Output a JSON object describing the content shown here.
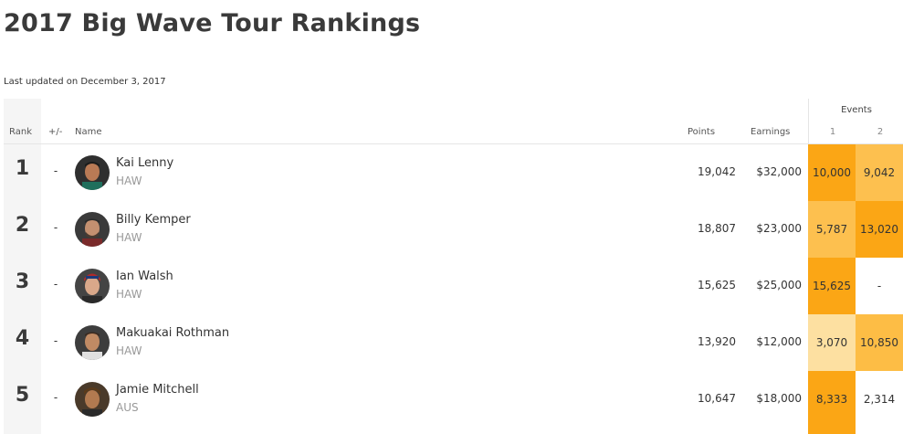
{
  "title": "2017 Big Wave Tour Rankings",
  "updated": "Last updated on December 3, 2017",
  "columns": {
    "rank": "Rank",
    "move": "+/-",
    "name": "Name",
    "points": "Points",
    "earnings": "Earnings",
    "events": "Events",
    "event_numbers": [
      "1",
      "2"
    ]
  },
  "colors": {
    "events_high": "#fba615",
    "events_mid": "#fdc04f",
    "events_low": "#fde0a1"
  },
  "rows": [
    {
      "rank": "1",
      "move": "-",
      "name": "Kai Lenny",
      "country": "HAW",
      "points": "19,042",
      "earnings": "$32,000",
      "events": [
        "10,000",
        "9,042"
      ]
    },
    {
      "rank": "2",
      "move": "-",
      "name": "Billy Kemper",
      "country": "HAW",
      "points": "18,807",
      "earnings": "$23,000",
      "events": [
        "5,787",
        "13,020"
      ]
    },
    {
      "rank": "3",
      "move": "-",
      "name": "Ian Walsh",
      "country": "HAW",
      "points": "15,625",
      "earnings": "$25,000",
      "events": [
        "15,625",
        "-"
      ]
    },
    {
      "rank": "4",
      "move": "-",
      "name": "Makuakai Rothman",
      "country": "HAW",
      "points": "13,920",
      "earnings": "$12,000",
      "events": [
        "3,070",
        "10,850"
      ]
    },
    {
      "rank": "5",
      "move": "-",
      "name": "Jamie Mitchell",
      "country": "AUS",
      "points": "10,647",
      "earnings": "$18,000",
      "events": [
        "8,333",
        "2,314"
      ]
    }
  ]
}
